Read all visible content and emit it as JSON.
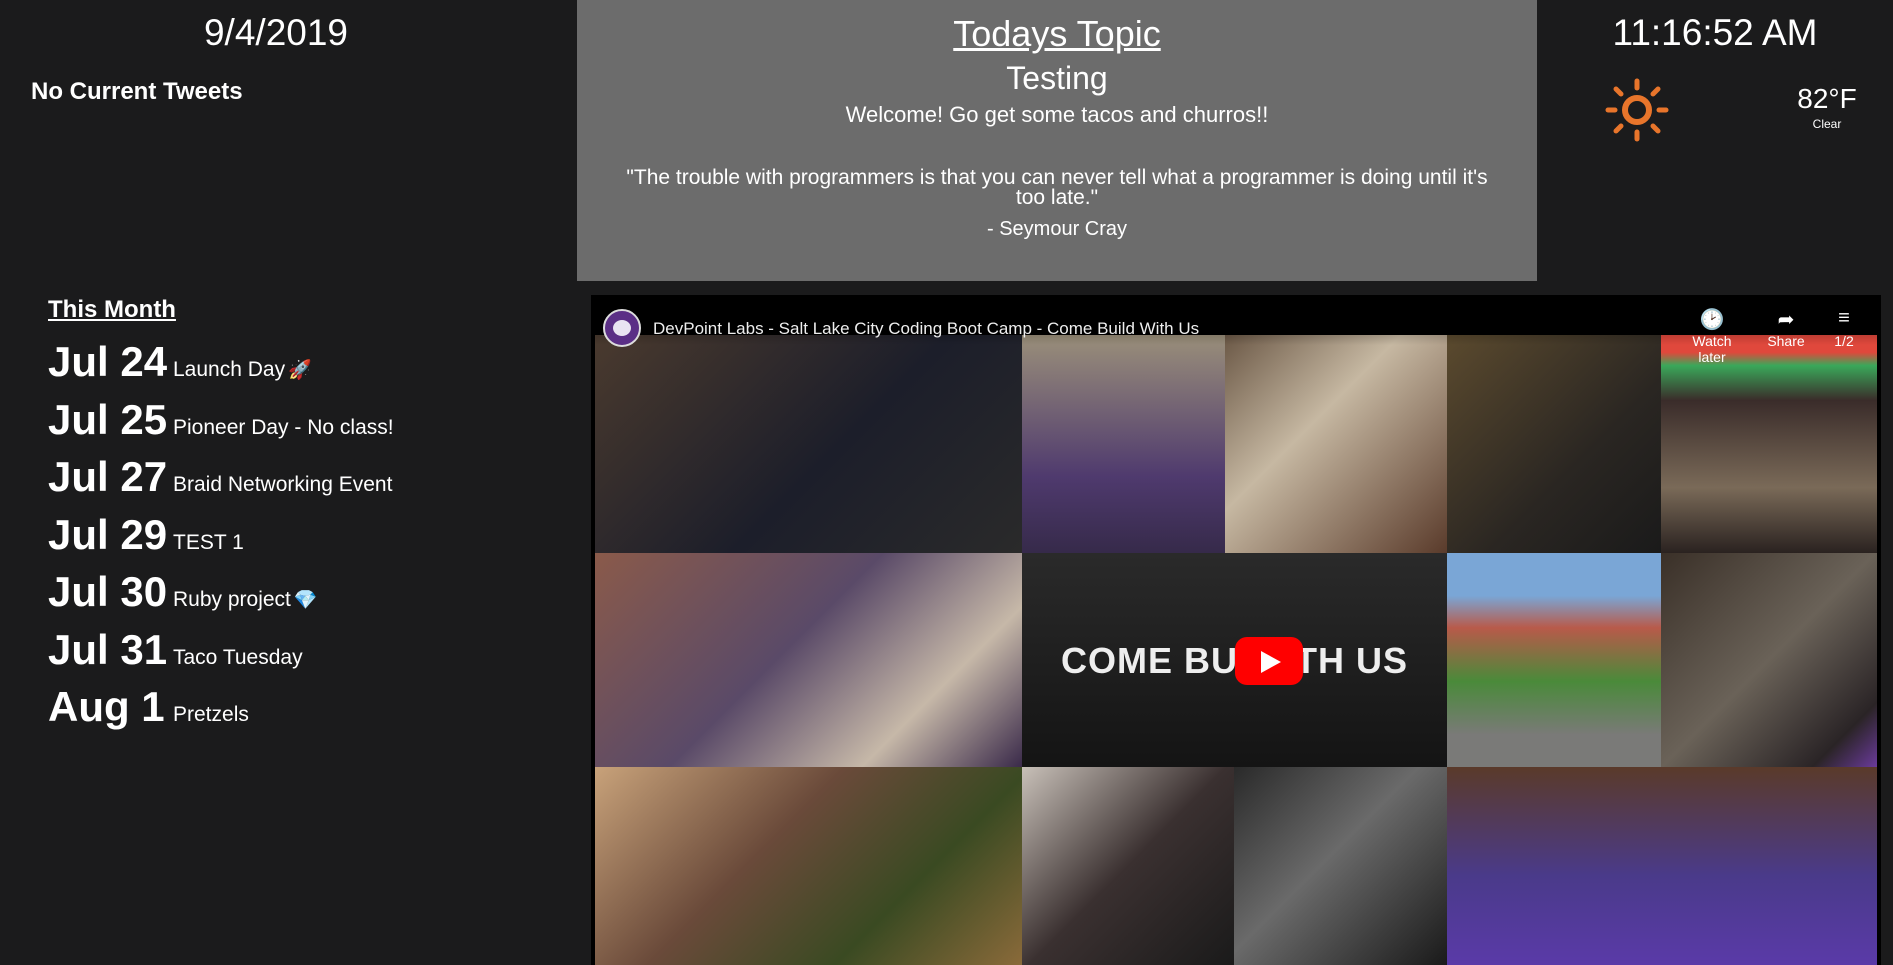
{
  "left": {
    "date": "9/4/2019",
    "tweets": "No Current Tweets",
    "month_title": "This Month",
    "events": [
      {
        "date": "Jul 24",
        "title": "Launch Day",
        "emoji": "🚀"
      },
      {
        "date": "Jul 25",
        "title": "Pioneer Day - No class!",
        "emoji": ""
      },
      {
        "date": "Jul 27",
        "title": "Braid Networking Event",
        "emoji": ""
      },
      {
        "date": "Jul 29",
        "title": "TEST 1",
        "emoji": ""
      },
      {
        "date": "Jul 30",
        "title": "Ruby project",
        "emoji": "💎"
      },
      {
        "date": "Jul 31",
        "title": "Taco Tuesday",
        "emoji": ""
      },
      {
        "date": "Aug 1",
        "title": "Pretzels",
        "emoji": ""
      }
    ]
  },
  "topic": {
    "heading": "Todays Topic",
    "subject": "Testing",
    "welcome": "Welcome! Go get some tacos and churros!!",
    "quote": "\"The trouble with programmers is that you can never tell what a programmer is doing until it's too late.\"",
    "author": "- Seymour Cray"
  },
  "right": {
    "time": "11:16:52 AM",
    "weather_icon": "sun-icon",
    "temperature": "82°F",
    "condition": "Clear"
  },
  "video": {
    "title": "DevPoint Labs - Salt Lake City Coding Boot Camp - Come Build With Us",
    "overlay_text": "COME BU    WITH US",
    "buttons": {
      "watch_later": "Watch later",
      "share": "Share",
      "playlist": "1/2"
    }
  },
  "colors": {
    "background": "#1b1b1c",
    "topic_panel": "#6c6c6c",
    "sun": "#e8752b",
    "play_button": "#ff0000"
  }
}
